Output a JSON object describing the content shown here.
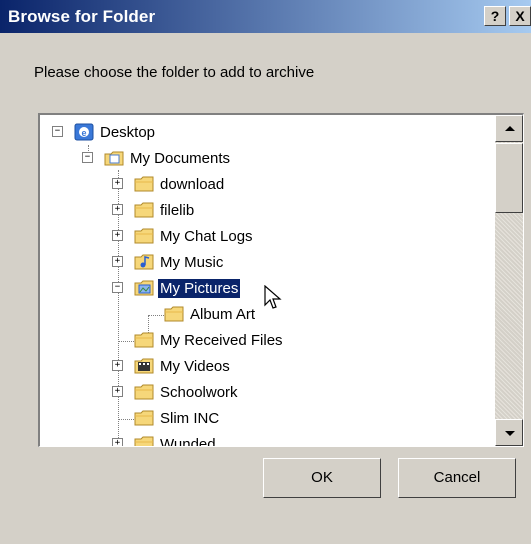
{
  "window": {
    "title": "Browse for Folder",
    "help_label": "?",
    "close_label": "X"
  },
  "prompt": "Please choose the folder to add to archive",
  "tree": {
    "nodes": [
      {
        "label": "Desktop",
        "icon": "desktop-icon",
        "expander": "−"
      },
      {
        "label": "My Documents",
        "icon": "documents-folder-icon",
        "expander": "−"
      },
      {
        "label": "download",
        "icon": "folder-icon",
        "expander": "+"
      },
      {
        "label": "filelib",
        "icon": "folder-icon",
        "expander": "+"
      },
      {
        "label": "My Chat Logs",
        "icon": "folder-icon",
        "expander": "+"
      },
      {
        "label": "My Music",
        "icon": "music-folder-icon",
        "expander": "+"
      },
      {
        "label": "My Pictures",
        "icon": "pictures-folder-icon",
        "expander": "−",
        "selected": true
      },
      {
        "label": "Album Art",
        "icon": "folder-icon"
      },
      {
        "label": "My Received Files",
        "icon": "folder-icon"
      },
      {
        "label": "My Videos",
        "icon": "video-folder-icon",
        "expander": "+"
      },
      {
        "label": "Schoolwork",
        "icon": "folder-icon",
        "expander": "+"
      },
      {
        "label": "Slim INC",
        "icon": "folder-icon"
      },
      {
        "label": "Wunded",
        "icon": "folder-icon",
        "expander": "+"
      }
    ]
  },
  "buttons": {
    "ok": "OK",
    "cancel": "Cancel"
  },
  "colors": {
    "title_start": "#0a246a",
    "title_end": "#a6caf0",
    "selection": "#0a246a",
    "face": "#d4d0c8"
  }
}
